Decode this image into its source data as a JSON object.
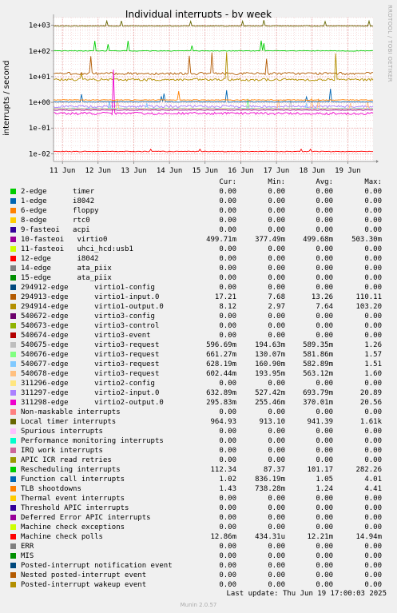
{
  "title": "Individual interrupts - by week",
  "side_text": "RRDTOOL / TOBI OETIKER",
  "ylabel": "interrupts / second",
  "chart_data": {
    "type": "line",
    "title": "Individual interrupts - by week",
    "ylabel": "interrupts / second",
    "xlabel": "",
    "yscale": "log",
    "ylim": [
      0.005,
      2000
    ],
    "yticks": [
      "1e+03",
      "1e+02",
      "1e+01",
      "1e+00",
      "1e-01",
      "1e-02"
    ],
    "ytick_values": [
      1000,
      100,
      10,
      1,
      0.1,
      0.01
    ],
    "xticks": [
      "11 Jun",
      "12 Jun",
      "13 Jun",
      "14 Jun",
      "15 Jun",
      "16 Jun",
      "17 Jun",
      "18 Jun",
      "19 Jun"
    ],
    "xlim_days": [
      "10 Jun 18:00",
      "19 Jun 17:00"
    ],
    "grid": true,
    "legend_position": "below",
    "series_drawn": [
      {
        "ref": "Local timer interrupts",
        "avg": 941.39,
        "min": 913.1,
        "max": 1610
      },
      {
        "ref": "Rescheduling interrupts",
        "avg": 101.17,
        "min": 87.37,
        "max": 282.26
      },
      {
        "ref": "294913-edge virtio1-input.0",
        "avg": 13.26,
        "min": 7.68,
        "max": 110.11
      },
      {
        "ref": "294914-edge virtio1-output.0",
        "avg": 7.64,
        "min": 2.97,
        "max": 103.2
      },
      {
        "ref": "311297-edge virtio2-input.0",
        "avg": 0.694,
        "min": 0.527,
        "max": 20.89
      },
      {
        "ref": "311298-edge virtio2-output.0",
        "avg": 0.37,
        "min": 0.255,
        "max": 20.56
      },
      {
        "ref": "540675-edge virtio3-request",
        "avg": 0.589,
        "min": 0.195,
        "max": 1.26
      },
      {
        "ref": "540676-edge virtio3-request",
        "avg": 0.582,
        "min": 0.13,
        "max": 1.57
      },
      {
        "ref": "540677-edge virtio3-request",
        "avg": 0.583,
        "min": 0.161,
        "max": 1.51
      },
      {
        "ref": "540678-edge virtio3-request",
        "avg": 0.563,
        "min": 0.194,
        "max": 1.6
      },
      {
        "ref": "10-fasteoi virtio0",
        "avg": 0.4997,
        "min": 0.3775,
        "max": 0.5033
      },
      {
        "ref": "Function call interrupts",
        "avg": 1.05,
        "min": 0.836,
        "max": 4.01
      },
      {
        "ref": "TLB shootdowns",
        "avg": 1.24,
        "min": 0.738,
        "max": 4.41
      },
      {
        "ref": "Machine check polls",
        "avg": 0.01221,
        "min": 0.000434,
        "max": 0.01494
      }
    ]
  },
  "legend": {
    "headers": {
      "cur": "Cur:",
      "min": "Min:",
      "avg": "Avg:",
      "max": "Max:"
    },
    "rows": [
      {
        "label": "2-edge      timer",
        "color": "#00cc00",
        "cur": "0.00",
        "min": "0.00",
        "avg": "0.00",
        "max": "0.00"
      },
      {
        "label": "1-edge      i8042",
        "color": "#0066b3",
        "cur": "0.00",
        "min": "0.00",
        "avg": "0.00",
        "max": "0.00"
      },
      {
        "label": "6-edge      floppy",
        "color": "#ff8000",
        "cur": "0.00",
        "min": "0.00",
        "avg": "0.00",
        "max": "0.00"
      },
      {
        "label": "8-edge      rtc0",
        "color": "#ffcc00",
        "cur": "0.00",
        "min": "0.00",
        "avg": "0.00",
        "max": "0.00"
      },
      {
        "label": "9-fasteoi   acpi",
        "color": "#330099",
        "cur": "0.00",
        "min": "0.00",
        "avg": "0.00",
        "max": "0.00"
      },
      {
        "label": "10-fasteoi   virtio0",
        "color": "#990099",
        "cur": "499.71m",
        "min": "377.49m",
        "avg": "499.68m",
        "max": "503.30m"
      },
      {
        "label": "11-fasteoi   uhci_hcd:usb1",
        "color": "#ccff00",
        "cur": "0.00",
        "min": "0.00",
        "avg": "0.00",
        "max": "0.00"
      },
      {
        "label": "12-edge      i8042",
        "color": "#ff0000",
        "cur": "0.00",
        "min": "0.00",
        "avg": "0.00",
        "max": "0.00"
      },
      {
        "label": "14-edge      ata_piix",
        "color": "#808080",
        "cur": "0.00",
        "min": "0.00",
        "avg": "0.00",
        "max": "0.00"
      },
      {
        "label": "15-edge      ata_piix",
        "color": "#008f00",
        "cur": "0.00",
        "min": "0.00",
        "avg": "0.00",
        "max": "0.00"
      },
      {
        "label": "294912-edge      virtio1-config",
        "color": "#00487d",
        "cur": "0.00",
        "min": "0.00",
        "avg": "0.00",
        "max": "0.00"
      },
      {
        "label": "294913-edge      virtio1-input.0",
        "color": "#b35a00",
        "cur": "17.21",
        "min": "7.68",
        "avg": "13.26",
        "max": "110.11"
      },
      {
        "label": "294914-edge      virtio1-output.0",
        "color": "#b38f00",
        "cur": "8.12",
        "min": "2.97",
        "avg": "7.64",
        "max": "103.20"
      },
      {
        "label": "540672-edge      virtio3-config",
        "color": "#6b006b",
        "cur": "0.00",
        "min": "0.00",
        "avg": "0.00",
        "max": "0.00"
      },
      {
        "label": "540673-edge      virtio3-control",
        "color": "#8fb300",
        "cur": "0.00",
        "min": "0.00",
        "avg": "0.00",
        "max": "0.00"
      },
      {
        "label": "540674-edge      virtio3-event",
        "color": "#b30000",
        "cur": "0.00",
        "min": "0.00",
        "avg": "0.00",
        "max": "0.00"
      },
      {
        "label": "540675-edge      virtio3-request",
        "color": "#bebebe",
        "cur": "596.69m",
        "min": "194.63m",
        "avg": "589.35m",
        "max": "1.26"
      },
      {
        "label": "540676-edge      virtio3-request",
        "color": "#80ff80",
        "cur": "661.27m",
        "min": "130.07m",
        "avg": "581.86m",
        "max": "1.57"
      },
      {
        "label": "540677-edge      virtio3-request",
        "color": "#80c9ff",
        "cur": "628.19m",
        "min": "160.90m",
        "avg": "582.89m",
        "max": "1.51"
      },
      {
        "label": "540678-edge      virtio3-request",
        "color": "#ffc080",
        "cur": "602.44m",
        "min": "193.95m",
        "avg": "563.12m",
        "max": "1.60"
      },
      {
        "label": "311296-edge      virtio2-config",
        "color": "#ffe680",
        "cur": "0.00",
        "min": "0.00",
        "avg": "0.00",
        "max": "0.00"
      },
      {
        "label": "311297-edge      virtio2-input.0",
        "color": "#aa80ff",
        "cur": "632.89m",
        "min": "527.42m",
        "avg": "693.79m",
        "max": "20.89"
      },
      {
        "label": "311298-edge      virtio2-output.0",
        "color": "#ee00cc",
        "cur": "295.83m",
        "min": "255.46m",
        "avg": "370.01m",
        "max": "20.56"
      },
      {
        "label": "Non-maskable interrupts",
        "color": "#ff8080",
        "cur": "0.00",
        "min": "0.00",
        "avg": "0.00",
        "max": "0.00"
      },
      {
        "label": "Local timer interrupts",
        "color": "#666600",
        "cur": "964.93",
        "min": "913.10",
        "avg": "941.39",
        "max": "1.61k"
      },
      {
        "label": "Spurious interrupts",
        "color": "#ffbfff",
        "cur": "0.00",
        "min": "0.00",
        "avg": "0.00",
        "max": "0.00"
      },
      {
        "label": "Performance monitoring interrupts",
        "color": "#00ffcc",
        "cur": "0.00",
        "min": "0.00",
        "avg": "0.00",
        "max": "0.00"
      },
      {
        "label": "IRQ work interrupts",
        "color": "#cc6699",
        "cur": "0.00",
        "min": "0.00",
        "avg": "0.00",
        "max": "0.00"
      },
      {
        "label": "APIC ICR read retries",
        "color": "#999900",
        "cur": "0.00",
        "min": "0.00",
        "avg": "0.00",
        "max": "0.00"
      },
      {
        "label": "Rescheduling interrupts",
        "color": "#00cc00",
        "cur": "112.34",
        "min": "87.37",
        "avg": "101.17",
        "max": "282.26"
      },
      {
        "label": "Function call interrupts",
        "color": "#0066b3",
        "cur": "1.02",
        "min": "836.19m",
        "avg": "1.05",
        "max": "4.01"
      },
      {
        "label": "TLB shootdowns",
        "color": "#ff8000",
        "cur": "1.43",
        "min": "738.28m",
        "avg": "1.24",
        "max": "4.41"
      },
      {
        "label": "Thermal event interrupts",
        "color": "#ffcc00",
        "cur": "0.00",
        "min": "0.00",
        "avg": "0.00",
        "max": "0.00"
      },
      {
        "label": "Threshold APIC interrupts",
        "color": "#330099",
        "cur": "0.00",
        "min": "0.00",
        "avg": "0.00",
        "max": "0.00"
      },
      {
        "label": "Deferred Error APIC interrupts",
        "color": "#990099",
        "cur": "0.00",
        "min": "0.00",
        "avg": "0.00",
        "max": "0.00"
      },
      {
        "label": "Machine check exceptions",
        "color": "#ccff00",
        "cur": "0.00",
        "min": "0.00",
        "avg": "0.00",
        "max": "0.00"
      },
      {
        "label": "Machine check polls",
        "color": "#ff0000",
        "cur": "12.86m",
        "min": "434.31u",
        "avg": "12.21m",
        "max": "14.94m"
      },
      {
        "label": "ERR",
        "color": "#808080",
        "cur": "0.00",
        "min": "0.00",
        "avg": "0.00",
        "max": "0.00"
      },
      {
        "label": "MIS",
        "color": "#008f00",
        "cur": "0.00",
        "min": "0.00",
        "avg": "0.00",
        "max": "0.00"
      },
      {
        "label": "Posted-interrupt notification event",
        "color": "#00487d",
        "cur": "0.00",
        "min": "0.00",
        "avg": "0.00",
        "max": "0.00"
      },
      {
        "label": "Nested posted-interrupt event",
        "color": "#b35a00",
        "cur": "0.00",
        "min": "0.00",
        "avg": "0.00",
        "max": "0.00"
      },
      {
        "label": "Posted-interrupt wakeup event",
        "color": "#b38f00",
        "cur": "0.00",
        "min": "0.00",
        "avg": "0.00",
        "max": "0.00"
      }
    ]
  },
  "last_update": "Last update:  Thu Jun 19 17:00:03 2025",
  "version": "Munin 2.0.57"
}
